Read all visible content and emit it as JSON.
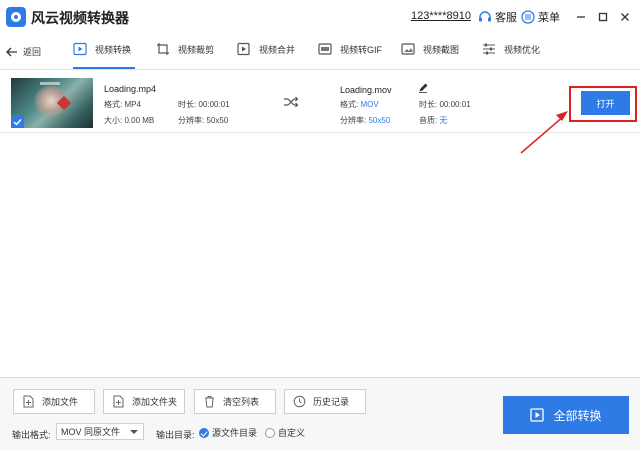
{
  "app": {
    "title": "风云视频转换器"
  },
  "titlebar": {
    "user_phone": "123****8910",
    "support_label": "客服",
    "menu_label": "菜单"
  },
  "nav": {
    "back_label": "返回",
    "tabs": [
      {
        "label": "视频转换",
        "icon": "convert-icon",
        "active": true
      },
      {
        "label": "视频裁剪",
        "icon": "crop-icon",
        "active": false
      },
      {
        "label": "视频合并",
        "icon": "merge-icon",
        "active": false
      },
      {
        "label": "视频转GIF",
        "icon": "gif-icon",
        "active": false
      },
      {
        "label": "视频截图",
        "icon": "screenshot-icon",
        "active": false
      },
      {
        "label": "视频优化",
        "icon": "optimize-icon",
        "active": false
      }
    ]
  },
  "file": {
    "source": {
      "name": "Loading.mp4",
      "format_key": "格式:",
      "format_val": "MP4",
      "duration_key": "时长:",
      "duration_val": "00:00:01",
      "size_key": "大小:",
      "size_val": "0.00 MB",
      "resolution_key": "分辨率:",
      "resolution_val": "50x50"
    },
    "output": {
      "name": "Loading.mov",
      "format_key": "格式:",
      "format_val": "MOV",
      "duration_key": "时长:",
      "duration_val": "00:00:01",
      "resolution_key": "分辨率:",
      "resolution_val": "50x50",
      "audio_key": "音质:",
      "audio_val": "无"
    },
    "open_label": "打开"
  },
  "bottom": {
    "add_file": "添加文件",
    "add_folder": "添加文件夹",
    "clear_list": "清空列表",
    "history": "历史记录",
    "format_label": "输出格式:",
    "format_value": "MOV 同原文件",
    "outdir_label": "输出目录:",
    "radio_source": "源文件目录",
    "radio_custom": "自定义",
    "convert_all": "全部转换"
  },
  "colors": {
    "accent": "#2f7be5",
    "highlight": "#e02020"
  }
}
